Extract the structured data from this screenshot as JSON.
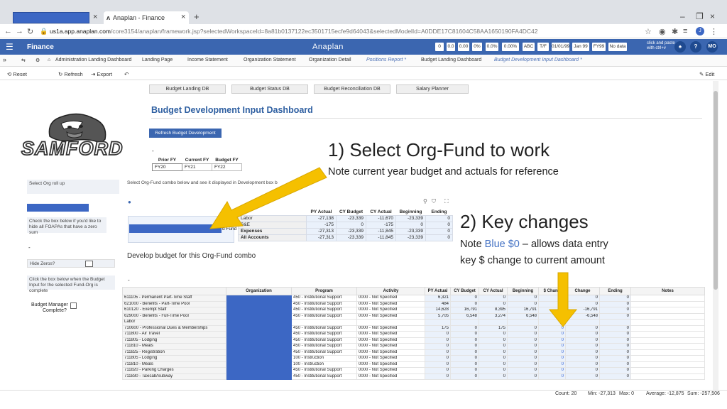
{
  "browser": {
    "tab_title": "Anaplan - Finance",
    "url_host": "us1a.app.anaplan.com",
    "url_rest": "/core3154/anaplan/framework.jsp?selectedWorkspaceId=8a81b0137122ec3501715ecfe9d64043&selectedModelId=A0DDE17C81604C58AA1650190FA4DC42",
    "profile_initial": "J"
  },
  "app": {
    "title": "Finance",
    "logo": "Anaplan",
    "header_boxes": [
      "0",
      "0.0",
      "0.00",
      "0%",
      "0.0%",
      "0.00%",
      "ABC",
      "T/F",
      "01/01/99",
      "Jan 99",
      "FY99",
      "No data"
    ],
    "click_paste": "click and paste\nwith ctrl+v",
    "user_initials": "MO",
    "help": "?"
  },
  "page_tabs": [
    "Administration Landing Dashboard",
    "Landing Page",
    "Income Statement",
    "Organization Statement",
    "Organization Detail",
    "Positions Report *",
    "Budget Landing Dashboard",
    "Budget Development Input Dashboard *"
  ],
  "toolbar": {
    "reset": "Reset",
    "refresh": "Refresh",
    "export": "Export",
    "edit": "Edit"
  },
  "nav_buttons": [
    "Budget Landing DB",
    "Budget Status DB",
    "Budget Reconciliation DB",
    "Salary Planner"
  ],
  "dashboard_title": "Budget Development Input Dashboard",
  "refresh_button": "Refresh Budget Development",
  "brand": "SAMFORD",
  "fy_table": {
    "headers": [
      "Prior FY",
      "Current FY",
      "Budget FY"
    ],
    "values": [
      "FY20",
      "FY21",
      "FY22"
    ]
  },
  "left_panel": {
    "org_rollup": "Select Org roll up",
    "check_box_note": "Check the box below if you'd like to hide all FOAPAs that have a zero sum",
    "hide_zeros": "Hide Zeros?",
    "complete_note": "Click the box below when the Budget Input for the selected Fund-Org is complete",
    "budget_manager": "Budget Manager",
    "complete": "Complete?"
  },
  "select_note": "Select Org-Fund combo below and see it displayed in Development box b",
  "annotations": {
    "step1_title": "1)  Select Org-Fund to work",
    "step1_note": "Note current year budget and actuals for reference",
    "step2_title": "2)  Key changes",
    "step2_note_a": "Note ",
    "step2_note_blue": "Blue $0",
    "step2_note_b": " – allows data entry",
    "step2_note_c": "key $ change to current amount"
  },
  "small_grid": {
    "fund_label": "d Fund",
    "headers": [
      "PY Actual",
      "CY Budget",
      "CY Actual",
      "Beginning",
      "Ending"
    ],
    "rows": [
      {
        "label": "Labor",
        "values": [
          "-27,138",
          "-23,339",
          "-11,670",
          "-23,339",
          "0"
        ]
      },
      {
        "label": "S&E",
        "values": [
          "-175",
          "0",
          "-175",
          "0",
          "0"
        ]
      },
      {
        "label": "Expenses",
        "values": [
          "-27,313",
          "-23,339",
          "-11,845",
          "-23,339",
          "0"
        ]
      },
      {
        "label": "All Accounts",
        "values": [
          "-27,313",
          "-23,339",
          "-11,845",
          "-23,339",
          "0"
        ]
      }
    ]
  },
  "develop_title": "Develop budget for this Org-Fund combo",
  "big_grid": {
    "headers": [
      "",
      "Organization",
      "Program",
      "Activity",
      "PY Actual",
      "CY Budget",
      "CY Actual",
      "Beginning",
      "$ Chang",
      "Change",
      "Ending",
      "Notes"
    ],
    "rows": [
      {
        "acct": "611105 - Permanent Part-Time Staff",
        "prog": "450 - Institutional Support",
        "act": "0000 - Not Specified",
        "v": [
          "6,321",
          "0",
          "0",
          "0",
          "",
          "0",
          "0"
        ]
      },
      {
        "acct": "621000 - Benefits - Part-Time Pool",
        "prog": "450 - Institutional Support",
        "act": "0000 - Not Specified",
        "v": [
          "484",
          "0",
          "0",
          "0",
          "",
          "0",
          "0"
        ]
      },
      {
        "acct": "610120 - Exempt Staff",
        "prog": "450 - Institutional Support",
        "act": "0000 - Not Specified",
        "v": [
          "14,628",
          "16,791",
          "8,395",
          "16,791",
          "",
          "-16,791",
          "0"
        ]
      },
      {
        "acct": "629000 - Benefits - Full-Time Pool",
        "prog": "450 - Institutional Support",
        "act": "0000 - Not Specified",
        "v": [
          "5,705",
          "6,548",
          "3,274",
          "6,548",
          "",
          "-6,548",
          "0"
        ]
      },
      {
        "acct": "Labor",
        "prog": "",
        "act": "",
        "v": [
          "",
          "",
          "",
          "",
          "",
          "",
          ""
        ]
      },
      {
        "acct": "710600 - Professional Dues & Memberships",
        "prog": "450 - Institutional Support",
        "act": "0000 - Not Specified",
        "v": [
          "175",
          "0",
          "175",
          "0",
          "0",
          "0",
          "0"
        ]
      },
      {
        "acct": "711800 - Air Travel",
        "prog": "450 - Institutional Support",
        "act": "0000 - Not Specified",
        "v": [
          "0",
          "0",
          "0",
          "0",
          "0",
          "0",
          "0"
        ]
      },
      {
        "acct": "711805 - Lodging",
        "prog": "450 - Institutional Support",
        "act": "0000 - Not Specified",
        "v": [
          "0",
          "0",
          "0",
          "0",
          "0",
          "0",
          "0"
        ]
      },
      {
        "acct": "711810 - Meals",
        "prog": "450 - Institutional Support",
        "act": "0000 - Not Specified",
        "v": [
          "0",
          "0",
          "0",
          "0",
          "0",
          "0",
          "0"
        ]
      },
      {
        "acct": "711825 - Registration",
        "prog": "450 - Institutional Support",
        "act": "0000 - Not Specified",
        "v": [
          "0",
          "0",
          "0",
          "0",
          "0",
          "0",
          "0"
        ]
      },
      {
        "acct": "711805 - Lodging",
        "prog": "100 - Instruction",
        "act": "0000 - Not Specified",
        "v": [
          "0",
          "0",
          "0",
          "0",
          "0",
          "0",
          "0"
        ]
      },
      {
        "acct": "711810 - Meals",
        "prog": "100 - Instruction",
        "act": "0000 - Not Specified",
        "v": [
          "0",
          "0",
          "0",
          "0",
          "0",
          "0",
          "0"
        ]
      },
      {
        "acct": "711820 - Parking Charges",
        "prog": "450 - Institutional Support",
        "act": "0000 - Not Specified",
        "v": [
          "0",
          "0",
          "0",
          "0",
          "0",
          "0",
          "0"
        ]
      },
      {
        "acct": "711830 - Taxicab/Subway",
        "prog": "450 - Institutional Support",
        "act": "0000 - Not Specified",
        "v": [
          "0",
          "0",
          "0",
          "0",
          "0",
          "0",
          "0"
        ]
      }
    ]
  },
  "status_bar": {
    "count": "Count: 20",
    "min": "Min: -27,313",
    "max": "Max: 0",
    "average": "Average: -12,875",
    "sum": "Sum: -257,506"
  },
  "colors": {
    "accent": "#3b66b0",
    "blue_value": "#4472c4",
    "arrow": "#f5c000"
  }
}
